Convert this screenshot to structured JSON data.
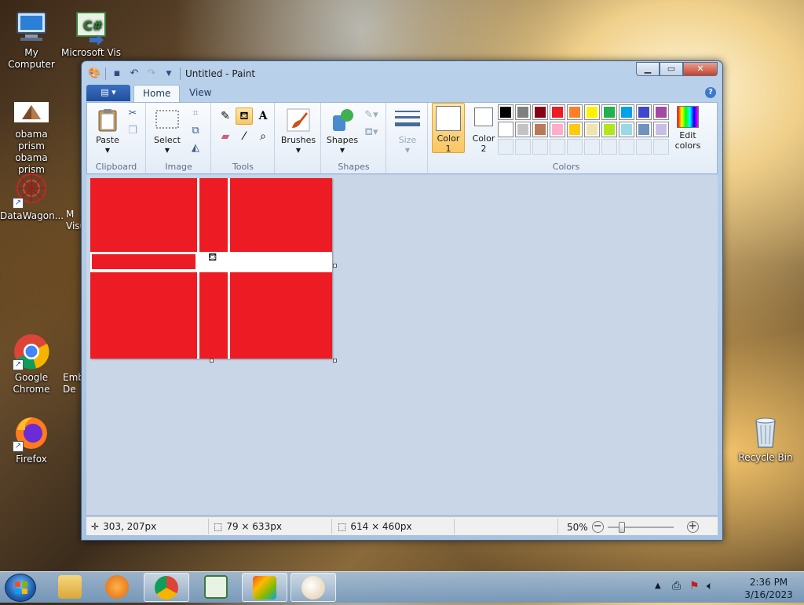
{
  "desktop": {
    "icons": [
      {
        "label": "My Computer"
      },
      {
        "label": "Microsoft Vis"
      },
      {
        "label": "obama prism obama prism"
      },
      {
        "label": "DataWagon..."
      },
      {
        "label": "M Visu"
      },
      {
        "label": "Google Chrome"
      },
      {
        "label": "Emb De"
      },
      {
        "label": "Firefox"
      },
      {
        "label": "Recycle Bin"
      }
    ]
  },
  "window": {
    "title": "Untitled - Paint",
    "tabs": [
      {
        "label": "Home"
      },
      {
        "label": "View"
      }
    ],
    "help": "?"
  },
  "ribbon": {
    "clipboard": {
      "paste": "Paste",
      "group": "Clipboard"
    },
    "image": {
      "select": "Select",
      "group": "Image"
    },
    "tools": {
      "group": "Tools",
      "text_glyph": "A"
    },
    "brushes": {
      "label": "Brushes"
    },
    "shapes": {
      "label": "Shapes",
      "group": "Shapes"
    },
    "size": {
      "label": "Size"
    },
    "colors": {
      "color1_line1": "Color",
      "color1_line2": "1",
      "color2_line1": "Color",
      "color2_line2": "2",
      "edit_line1": "Edit",
      "edit_line2": "colors",
      "group": "Colors",
      "color1_value": "#ffffff",
      "color2_value": "#ffffff",
      "palette_row1": [
        "#000000",
        "#7f7f7f",
        "#880015",
        "#ed1c24",
        "#ff7f27",
        "#fff200",
        "#22b14c",
        "#00a2e8",
        "#3f48cc",
        "#a349a4"
      ],
      "palette_row2": [
        "#ffffff",
        "#c3c3c3",
        "#b97a57",
        "#ffaec9",
        "#ffc90e",
        "#efe4b0",
        "#b5e61d",
        "#99d9ea",
        "#7092be",
        "#c8bfe7"
      ]
    }
  },
  "canvas": {
    "background": "#ffffff",
    "shape_color": "#ed1c24"
  },
  "status": {
    "cursor_pos": "303, 207px",
    "selection_size": "79 × 633px",
    "image_size": "614 × 460px",
    "zoom": "50%"
  },
  "taskbar": {
    "time": "2:36 PM",
    "date": "3/16/2023"
  }
}
